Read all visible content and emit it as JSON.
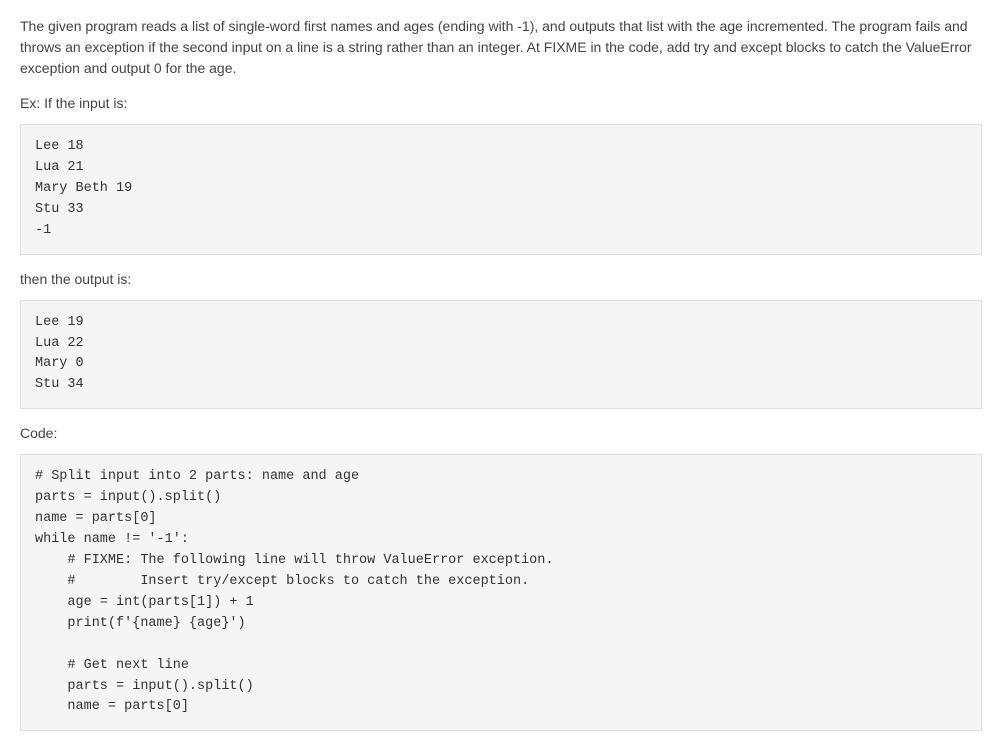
{
  "description": "The given program reads a list of single-word first names and ages (ending with -1), and outputs that list with the age incremented. The program fails and throws an exception if the second input on a line is a string rather than an integer. At FIXME in the code, add try and except blocks to catch the ValueError exception and output 0 for the age.",
  "example_label": "Ex: If the input is:",
  "input_block": "Lee 18\nLua 21\nMary Beth 19\nStu 33\n-1",
  "output_label": "then the output is:",
  "output_block": "Lee 19\nLua 22\nMary 0\nStu 34",
  "code_label": "Code:",
  "code_block": "# Split input into 2 parts: name and age\nparts = input().split()\nname = parts[0]\nwhile name != '-1':\n    # FIXME: The following line will throw ValueError exception.\n    #        Insert try/except blocks to catch the exception.\n    age = int(parts[1]) + 1\n    print(f'{name} {age}')\n\n    # Get next line\n    parts = input().split()\n    name = parts[0]"
}
